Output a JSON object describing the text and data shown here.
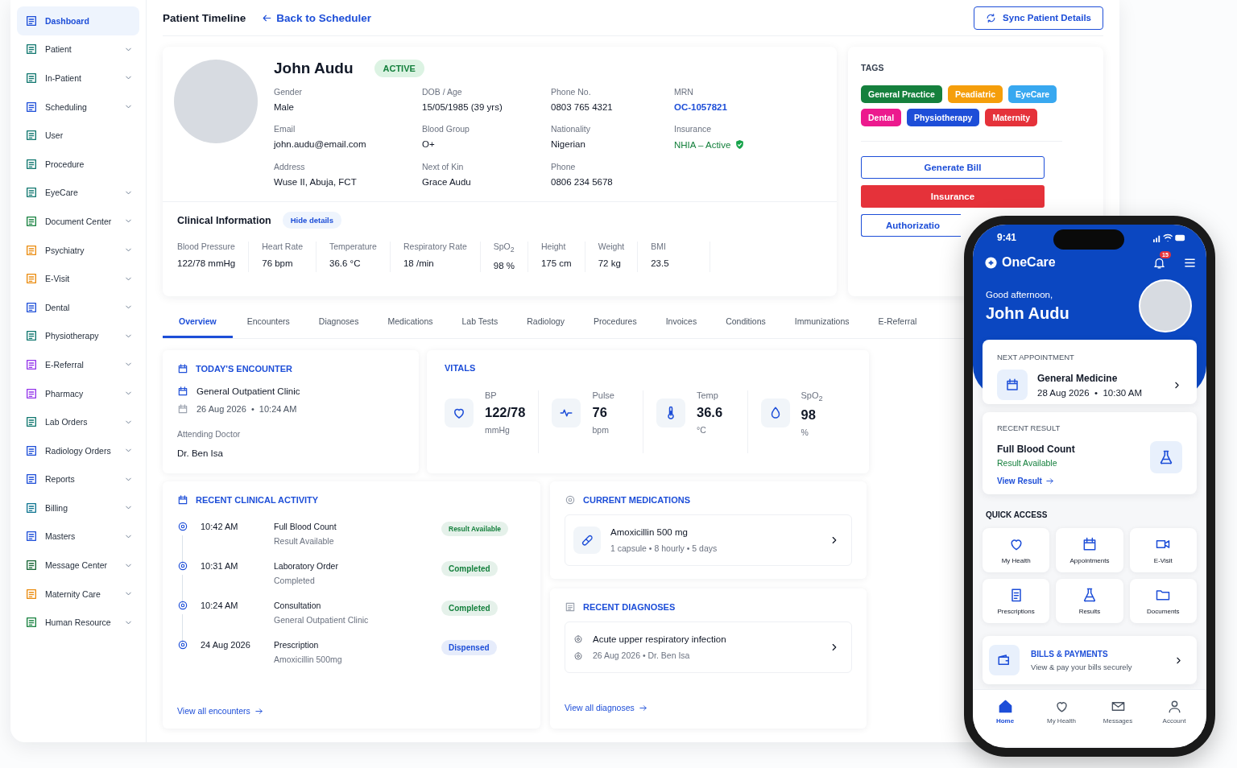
{
  "sidebar": {
    "items": [
      {
        "label": "Dashboard",
        "selected": true,
        "expandable": false
      },
      {
        "label": "Patient",
        "selected": false,
        "expandable": true
      },
      {
        "label": "In-Patient",
        "selected": false,
        "expandable": true
      },
      {
        "label": "Scheduling",
        "selected": false,
        "expandable": true
      },
      {
        "label": "User",
        "selected": false,
        "expandable": false
      },
      {
        "label": "Procedure",
        "selected": false,
        "expandable": false
      },
      {
        "label": "EyeCare",
        "selected": false,
        "expandable": true
      },
      {
        "label": "Document Center",
        "selected": false,
        "expandable": true
      },
      {
        "label": "Psychiatry",
        "selected": false,
        "expandable": true
      },
      {
        "label": "E-Visit",
        "selected": false,
        "expandable": true
      },
      {
        "label": "Dental",
        "selected": false,
        "expandable": true
      },
      {
        "label": "Physiotherapy",
        "selected": false,
        "expandable": true
      },
      {
        "label": "E-Referral",
        "selected": false,
        "expandable": true
      },
      {
        "label": "Pharmacy",
        "selected": false,
        "expandable": true
      },
      {
        "label": "Lab Orders",
        "selected": false,
        "expandable": true
      },
      {
        "label": "Radiology Orders",
        "selected": false,
        "expandable": true
      },
      {
        "label": "Reports",
        "selected": false,
        "expandable": true
      },
      {
        "label": "Billing",
        "selected": false,
        "expandable": true
      },
      {
        "label": "Masters",
        "selected": false,
        "expandable": true
      },
      {
        "label": "Message Center",
        "selected": false,
        "expandable": true
      },
      {
        "label": "Maternity Care",
        "selected": false,
        "expandable": true
      },
      {
        "label": "Human Resource",
        "selected": false,
        "expandable": true
      }
    ]
  },
  "header": {
    "title": "Patient Timeline",
    "back_link": "Back to Scheduler",
    "sync_button": "Sync Patient Details"
  },
  "patient": {
    "name": "John Audu",
    "status": "ACTIVE",
    "fields": [
      {
        "label": "Gender",
        "value": "Male",
        "kind": "text"
      },
      {
        "label": "DOB / Age",
        "value": "15/05/1985 (39 yrs)",
        "kind": "text"
      },
      {
        "label": "Phone No.",
        "value": "0803 765 4321",
        "kind": "text"
      },
      {
        "label": "MRN",
        "value": "OC-1057821",
        "kind": "link"
      },
      {
        "label": "Email",
        "value": "john.audu@email.com",
        "kind": "text"
      },
      {
        "label": "Blood Group",
        "value": "O+",
        "kind": "text"
      },
      {
        "label": "Nationality",
        "value": "Nigerian",
        "kind": "text"
      },
      {
        "label": "Insurance",
        "value": "NHIA – Active",
        "kind": "verified"
      },
      {
        "label": "Address",
        "value": "Wuse II, Abuja, FCT",
        "kind": "text"
      },
      {
        "label": "Next of Kin",
        "value": "Grace Audu",
        "kind": "text"
      },
      {
        "label": "Phone",
        "value": "0806 234 5678",
        "kind": "text"
      }
    ]
  },
  "clinical_info": {
    "title": "Clinical Information",
    "toggle": "Hide details",
    "metrics": [
      {
        "label": "Blood Pressure",
        "value": "122/78 mmHg"
      },
      {
        "label": "Heart Rate",
        "value": "76 bpm"
      },
      {
        "label": "Temperature",
        "value": "36.6 °C"
      },
      {
        "label": "Respiratory Rate",
        "value": "18 /min"
      },
      {
        "label": "SpO$_{2}$",
        "value": "98 %"
      },
      {
        "label": "Height",
        "value": "175 cm"
      },
      {
        "label": "Weight",
        "value": "72 kg"
      },
      {
        "label": "BMI",
        "value": "23.5"
      }
    ]
  },
  "tags": {
    "title": "TAGS",
    "items": [
      {
        "label": "General Practice",
        "color": "#15803d"
      },
      {
        "label": "Peadiatric",
        "color": "#f59e0b"
      },
      {
        "label": "EyeCare",
        "color": "#38a8f0"
      },
      {
        "label": "Dental",
        "color": "#ec1a8e"
      },
      {
        "label": "Physiotherapy",
        "color": "#1d4ed8"
      },
      {
        "label": "Maternity",
        "color": "#e5323a"
      }
    ],
    "actions": [
      {
        "label": "Generate Bill",
        "kind": "outline"
      },
      {
        "label": "Insurance",
        "kind": "danger"
      },
      {
        "label": "Authorizatio",
        "kind": "outline"
      }
    ]
  },
  "tabs": [
    {
      "label": "Overview",
      "selected": true
    },
    {
      "label": "Encounters",
      "selected": false
    },
    {
      "label": "Diagnoses",
      "selected": false
    },
    {
      "label": "Medications",
      "selected": false
    },
    {
      "label": "Lab Tests",
      "selected": false
    },
    {
      "label": "Radiology",
      "selected": false
    },
    {
      "label": "Procedures",
      "selected": false
    },
    {
      "label": "Invoices",
      "selected": false
    },
    {
      "label": "Conditions",
      "selected": false
    },
    {
      "label": "Immunizations",
      "selected": false
    },
    {
      "label": "E-Referral",
      "selected": false
    }
  ],
  "encounter": {
    "title": "TODAY'S ENCOUNTER",
    "clinic": "General Outpatient Clinic",
    "when": "26 Aug 2026  •  10:24 AM",
    "doctor_label": "Attending Doctor",
    "doctor": "Dr. Ben Isa"
  },
  "vitals": {
    "title": "VITALS",
    "items": [
      {
        "kind": "heart",
        "label": "BP",
        "value": "122/78",
        "unit": "mmHg"
      },
      {
        "kind": "pulse",
        "label": "Pulse",
        "value": "76",
        "unit": "bpm"
      },
      {
        "kind": "thermometer",
        "label": "Temp",
        "value": "36.6",
        "unit": "°C"
      },
      {
        "kind": "drop",
        "label": "SpO$_{2}$",
        "value": "98",
        "unit": "%"
      }
    ]
  },
  "activity": {
    "title": "RECENT CLINICAL ACTIVITY",
    "items": [
      {
        "time": "10:42 AM",
        "title": "Full Blood Count",
        "subtitle": "Result Available",
        "status": "Result Available",
        "color": "#15803d"
      },
      {
        "time": "10:31 AM",
        "title": "Laboratory Order",
        "subtitle": "Completed",
        "status": "Completed",
        "color": "#15803d"
      },
      {
        "time": "10:24 AM",
        "title": "Consultation",
        "subtitle": "General Outpatient Clinic",
        "status": "Completed",
        "color": "#15803d"
      },
      {
        "time": "24 Aug 2026",
        "title": "Prescription",
        "subtitle": "Amoxicillin 500mg",
        "status": "Dispensed",
        "color": "#1d4ed8"
      }
    ],
    "link": "View all encounters"
  },
  "medications": {
    "title": "CURRENT MEDICATIONS",
    "items": [
      {
        "name": "Amoxicillin 500 mg",
        "detail": "1 capsule • 8 hourly • 5 days"
      }
    ]
  },
  "diagnoses": {
    "title": "RECENT DIAGNOSES",
    "items": [
      {
        "name": "Acute upper respiratory infection",
        "detail": "26 Aug 2026 • Dr. Ben Isa"
      }
    ],
    "link": "View all diagnoses"
  },
  "phone": {
    "time": "9:41",
    "brand": "OneCare",
    "notifications": "15",
    "greeting": "Good afternoon,",
    "name": "John Audu",
    "next_appointment": {
      "title": "NEXT APPOINTMENT",
      "name": "General Medicine",
      "when": "28 Aug 2026  •  10:30 AM"
    },
    "recent_result": {
      "title": "RECENT RESULT",
      "name": "Full Blood Count",
      "status": "Result Available",
      "link": "View Result"
    },
    "quick_access": {
      "title": "QUICK ACCESS",
      "items": [
        {
          "kind": "heart",
          "label": "My Health"
        },
        {
          "kind": "calendar",
          "label": "Appointments"
        },
        {
          "kind": "video",
          "label": "E-Visit"
        },
        {
          "kind": "prescription",
          "label": "Prescriptions"
        },
        {
          "kind": "flask",
          "label": "Results"
        },
        {
          "kind": "folder",
          "label": "Documents"
        }
      ]
    },
    "bills": {
      "title": "BILLS & PAYMENTS",
      "subtitle": "View & pay your bills securely"
    },
    "nav": [
      {
        "kind": "home",
        "label": "Home",
        "selected": true
      },
      {
        "kind": "heart",
        "label": "My Health",
        "selected": false
      },
      {
        "kind": "mail",
        "label": "Messages",
        "selected": false
      },
      {
        "kind": "user",
        "label": "Account",
        "selected": false
      }
    ]
  }
}
